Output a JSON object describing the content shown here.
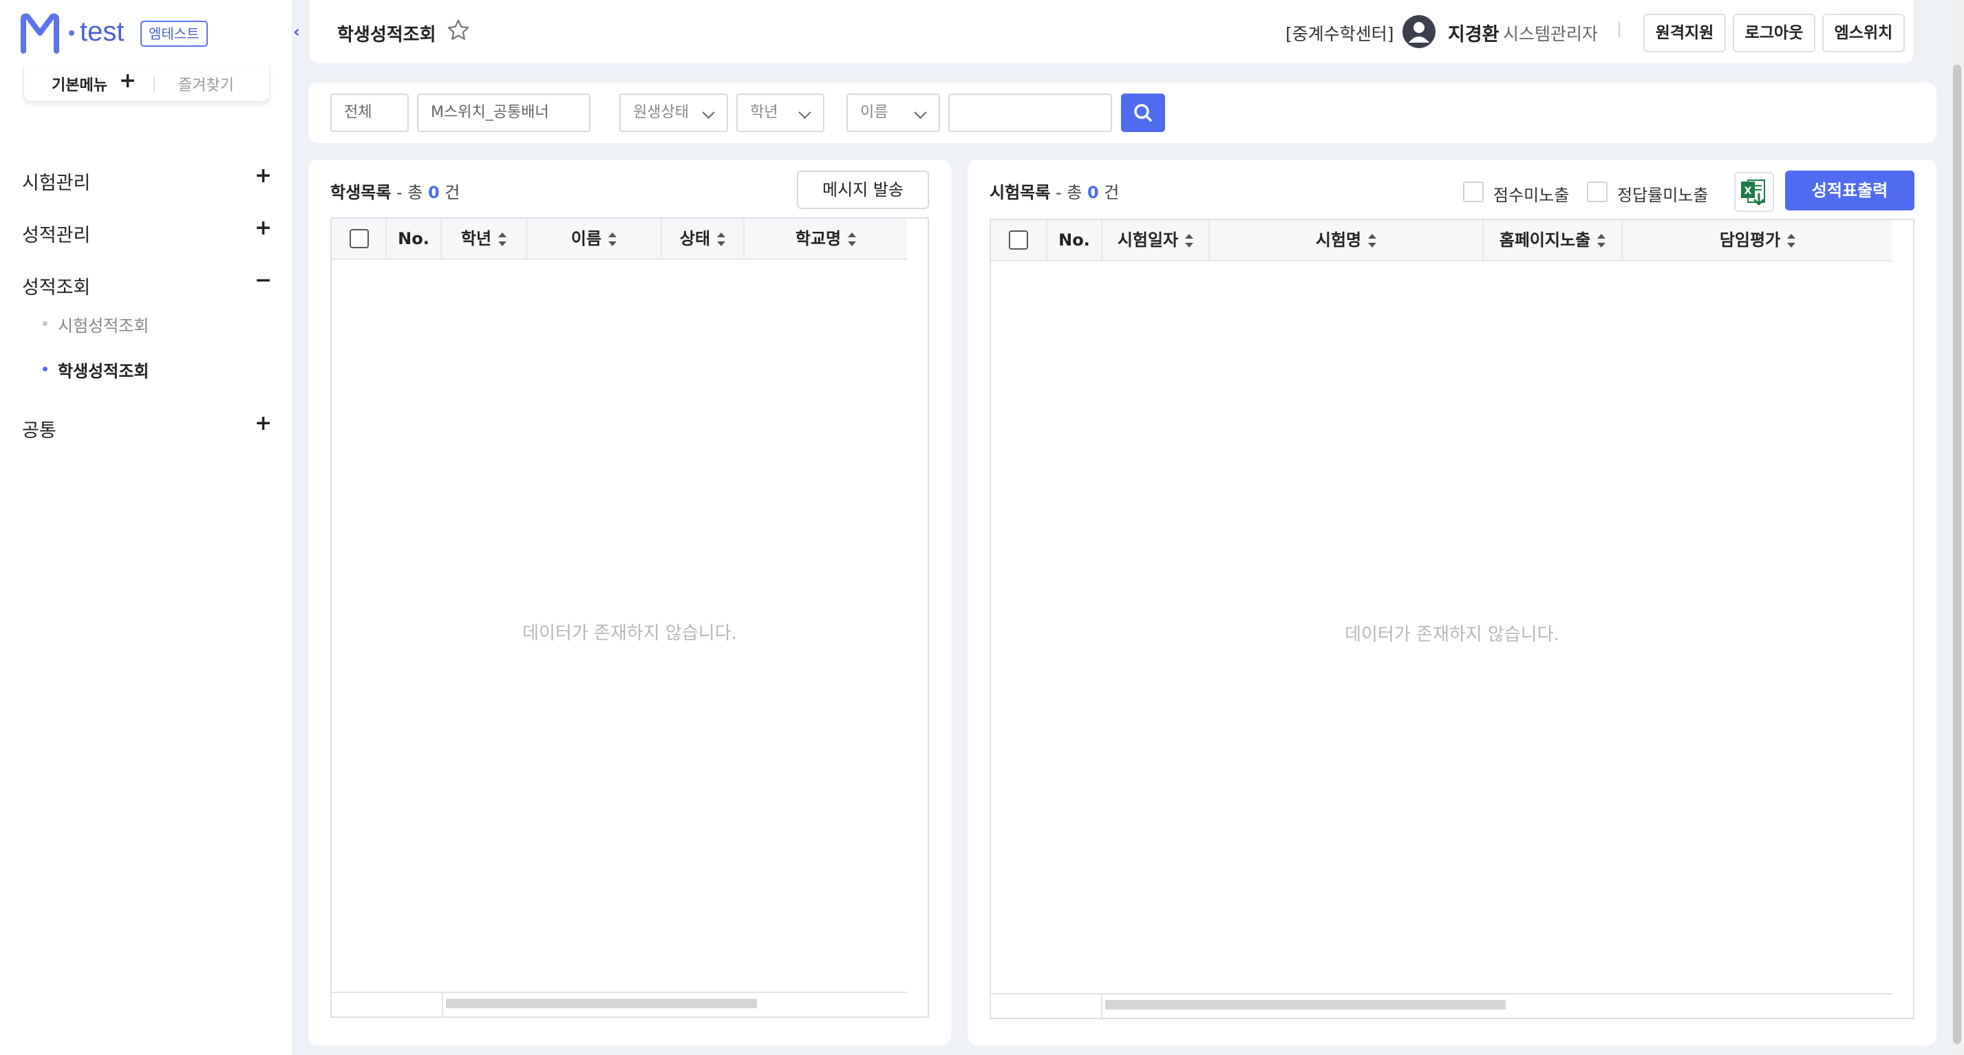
{
  "app": {
    "logo_text": "test",
    "badge": "엠테스트"
  },
  "sidebar": {
    "tabs": {
      "basic": "기본메뉴",
      "favorites": "즐겨찾기"
    },
    "menu": [
      {
        "label": "시험관리",
        "sign": "+"
      },
      {
        "label": "성적관리",
        "sign": "+"
      },
      {
        "label": "성적조회",
        "sign": "−"
      },
      {
        "label": "공통",
        "sign": "+"
      }
    ],
    "submenu": [
      {
        "label": "시험성적조회"
      },
      {
        "label": "학생성적조회"
      }
    ]
  },
  "header": {
    "page_title": "학생성적조회",
    "center": "[중계수학센터]",
    "user_name": "지경환",
    "user_role": "시스템관리자",
    "buttons": [
      "원격지원",
      "로그아웃",
      "엠스위치"
    ]
  },
  "filters": {
    "scope": "전체",
    "class": "M스위치_공통배너",
    "status": "원생상태",
    "grade": "학년",
    "search_field": "이름",
    "search_value": ""
  },
  "students_panel": {
    "title": "학생목록",
    "total_prefix": " - 총 ",
    "count": "0",
    "total_suffix": " 건",
    "send_button": "메시지 발송",
    "columns": [
      "No.",
      "학년",
      "이름",
      "상태",
      "학교명"
    ],
    "empty": "데이터가 존재하지 않습니다."
  },
  "exams_panel": {
    "title": "시험목록",
    "total_prefix": " - 총 ",
    "count": "0",
    "total_suffix": " 건",
    "options": [
      "점수미노출",
      "정답률미노출"
    ],
    "print_button": "성적표출력",
    "columns": [
      "No.",
      "시험일자",
      "시험명",
      "홈페이지노출",
      "담임평가"
    ],
    "empty": "데이터가 존재하지 않습니다."
  },
  "colors": {
    "accent": "#4f6cf0",
    "logo": "#4b5fd6",
    "excel": "#1f7a45"
  }
}
